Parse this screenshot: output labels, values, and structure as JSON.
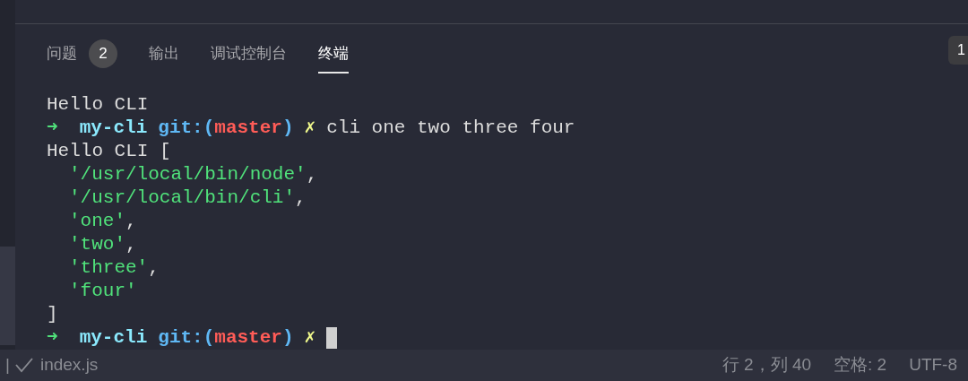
{
  "panel_tabs": [
    {
      "label": "问题",
      "badge": "2",
      "selected": false
    },
    {
      "label": "输出",
      "selected": false
    },
    {
      "label": "调试控制台",
      "selected": false
    },
    {
      "label": "终端",
      "selected": true
    }
  ],
  "terminal_selector": "1",
  "terminal_lines": [
    {
      "indented": false,
      "segments": [
        {
          "kind": "plain",
          "text": "Hello CLI"
        }
      ]
    },
    {
      "indented": false,
      "segments": [
        {
          "kind": "arrow",
          "text": "➜"
        },
        {
          "kind": "dir",
          "text": "my-cli"
        },
        {
          "kind": "git",
          "text": "git:("
        },
        {
          "kind": "branch",
          "text": "master"
        },
        {
          "kind": "git",
          "text": ")"
        },
        {
          "kind": "dirty",
          "text": "✗"
        },
        {
          "kind": "plain",
          "text": "cli one two three four"
        }
      ]
    },
    {
      "indented": false,
      "segments": [
        {
          "kind": "plain",
          "text": "Hello CLI ["
        }
      ]
    },
    {
      "indented": true,
      "segments": [
        {
          "kind": "string",
          "text": "'/usr/local/bin/node'"
        },
        {
          "kind": "punct",
          "text": ","
        }
      ]
    },
    {
      "indented": true,
      "segments": [
        {
          "kind": "string",
          "text": "'/usr/local/bin/cli'"
        },
        {
          "kind": "punct",
          "text": ","
        }
      ]
    },
    {
      "indented": true,
      "segments": [
        {
          "kind": "string",
          "text": "'one'"
        },
        {
          "kind": "punct",
          "text": ","
        }
      ]
    },
    {
      "indented": true,
      "segments": [
        {
          "kind": "string",
          "text": "'two'"
        },
        {
          "kind": "punct",
          "text": ","
        }
      ]
    },
    {
      "indented": true,
      "segments": [
        {
          "kind": "string",
          "text": "'three'"
        },
        {
          "kind": "punct",
          "text": ","
        }
      ]
    },
    {
      "indented": true,
      "segments": [
        {
          "kind": "string",
          "text": "'four'"
        }
      ]
    },
    {
      "indented": false,
      "segments": [
        {
          "kind": "plain",
          "text": "]"
        }
      ]
    },
    {
      "indented": false,
      "cursor": true,
      "segments": [
        {
          "kind": "arrow",
          "text": "➜"
        },
        {
          "kind": "dir",
          "text": "my-cli"
        },
        {
          "kind": "git",
          "text": "git:("
        },
        {
          "kind": "branch",
          "text": "master"
        },
        {
          "kind": "git",
          "text": ")"
        },
        {
          "kind": "dirty",
          "text": "✗"
        }
      ]
    }
  ],
  "status_bar": {
    "separator": "|",
    "file": "index.js",
    "position": "行 2，列 40",
    "indent": "空格: 2",
    "encoding": "UTF-8"
  }
}
